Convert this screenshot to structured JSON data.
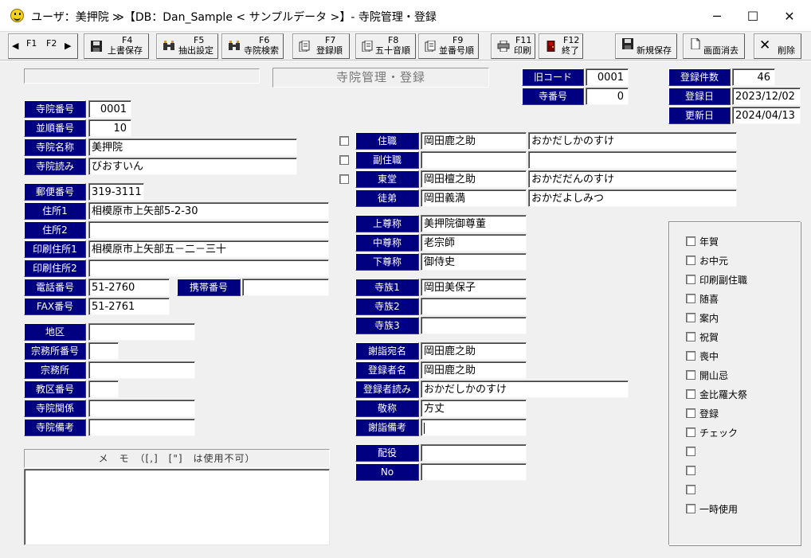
{
  "window": {
    "title": "ユーザ：美押院 ≫【DB：Dan_Sample < サンプルデータ >】- 寺院管理・登録",
    "minimize": "─",
    "maximize": "☐",
    "close": "✕"
  },
  "toolbar": {
    "nav": {
      "prev": "◀",
      "f1": "F1",
      "f2": "F2",
      "next": "▶"
    },
    "buttons": [
      {
        "key": "F4",
        "label": "上書保存",
        "icon": "floppy-disk-icon"
      },
      {
        "key": "F5",
        "label": "抽出設定",
        "icon": "binoculars-icon"
      },
      {
        "key": "F6",
        "label": "寺院検索",
        "icon": "search-binoculars-icon"
      },
      {
        "key": "F7",
        "label": "登録順",
        "icon": "pages-icon"
      },
      {
        "key": "F8",
        "label": "五十音順",
        "icon": "pages-icon"
      },
      {
        "key": "F9",
        "label": "並番号順",
        "icon": "pages-icon"
      },
      {
        "key": "F11",
        "label": "印刷",
        "icon": "printer-icon"
      },
      {
        "key": "F12",
        "label": "終了",
        "icon": "exit-door-icon"
      }
    ],
    "save_new": "新規保存",
    "clear": "画面消去",
    "delete": "削除",
    "delete_mark": "✕"
  },
  "form": {
    "title": "寺院管理・登録",
    "header": {
      "old_code_label": "旧コード",
      "old_code": "0001",
      "temple_no_label": "寺番号",
      "temple_no": "0",
      "count_label": "登録件数",
      "count": "46",
      "reg_date_label": "登録日",
      "reg_date": "2023/12/02",
      "upd_date_label": "更新日",
      "upd_date": "2024/04/13"
    },
    "temple": {
      "number_label": "寺院番号",
      "number": "0001",
      "order_label": "並順番号",
      "order": "10",
      "name_label": "寺院名称",
      "name": "美押院",
      "reading_label": "寺院読み",
      "reading": "びおすいん",
      "postal_label": "郵便番号",
      "postal": "319-3111",
      "address1_label": "住所1",
      "address1": "相模原市上矢部5-2-30",
      "address2_label": "住所2",
      "address2": "",
      "print_address1_label": "印刷住所1",
      "print_address1": "相模原市上矢部五－二－三十",
      "print_address2_label": "印刷住所2",
      "print_address2": "",
      "phone_label": "電話番号",
      "phone": "51-2760",
      "mobile_label": "携帯番号",
      "mobile": "",
      "fax_label": "FAX番号",
      "fax": "51-2761",
      "district_label": "地区",
      "district": "",
      "sect_office_no_label": "宗務所番号",
      "sect_office_no": "",
      "sect_office_label": "宗務所",
      "sect_office": "",
      "parish_no_label": "教区番号",
      "parish_no": "",
      "relation_label": "寺院関係",
      "relation": "",
      "notes_label": "寺院備考",
      "notes": ""
    },
    "memo_label": "メ　モ　（[,]　[\"]　は使用不可）",
    "people": {
      "chief_label": "住職",
      "chief_name": "岡田鹿之助",
      "chief_reading": "おかだしかのすけ",
      "vice_label": "副住職",
      "vice_name": "",
      "vice_reading": "",
      "east_label": "東堂",
      "east_name": "岡田檀之助",
      "east_reading": "おかだだんのすけ",
      "disciple_label": "徒弟",
      "disciple_name": "岡田義満",
      "disciple_reading": "おかだよしみつ"
    },
    "honorifics": {
      "upper_label": "上尊称",
      "upper": "美押院御尊董",
      "middle_label": "中尊称",
      "middle": "老宗師",
      "lower_label": "下尊称",
      "lower": "御侍史"
    },
    "family": {
      "f1_label": "寺族1",
      "f1": "岡田美保子",
      "f2_label": "寺族2",
      "f2": "",
      "f3_label": "寺族3",
      "f3": ""
    },
    "address_info": {
      "addressee_label": "謝詣宛名",
      "addressee": "岡田鹿之助",
      "registrant_label": "登録者名",
      "registrant": "岡田鹿之助",
      "registrant_reading_label": "登録者読み",
      "registrant_reading": "おかだしかのすけ",
      "title_label": "敬称",
      "title": "方丈",
      "notes_label": "謝詣備考",
      "notes": ""
    },
    "role": {
      "role_label": "配役",
      "role": "",
      "no_label": "No",
      "no": ""
    },
    "options": [
      "年賀",
      "お中元",
      "印刷副住職",
      "随喜",
      "案内",
      "祝賀",
      "喪中",
      "開山忌",
      "金比羅大祭",
      "登録",
      "チェック",
      "",
      "",
      "",
      "一時使用"
    ]
  },
  "colors": {
    "label_bg": "#000080",
    "face": "#f0f0f0"
  }
}
